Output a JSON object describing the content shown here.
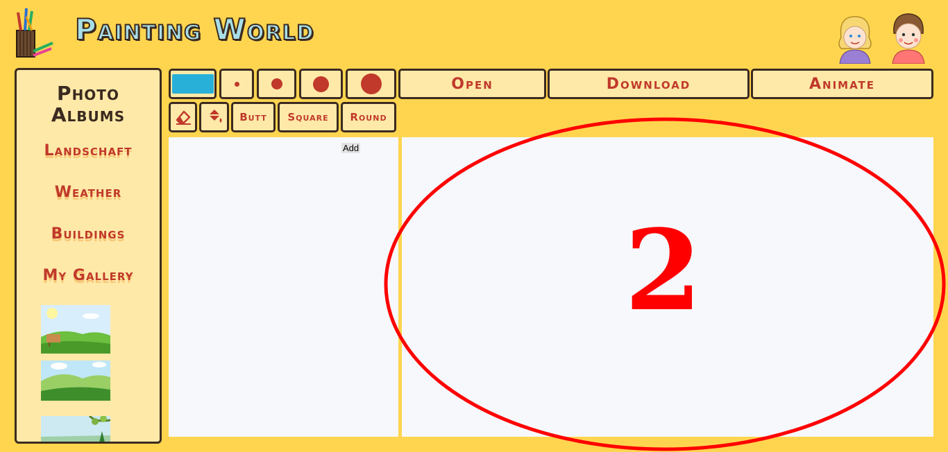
{
  "app": {
    "title": "Painting World"
  },
  "header": {
    "logo_icon": "pencil-cup-icon",
    "avatars": [
      "girl-avatar-icon",
      "boy-avatar-icon"
    ]
  },
  "sidebar": {
    "title": "Photo Albums",
    "albums": [
      {
        "label": "Landschaft"
      },
      {
        "label": "Weather"
      },
      {
        "label": "Buildings"
      },
      {
        "label": "My Gallery"
      }
    ],
    "thumbnail_icons": [
      "meadow-sign-thumbnail",
      "hills-clouds-thumbnail",
      "tree-branch-thumbnail"
    ]
  },
  "toolbar": {
    "selected_color": "#29b0d9",
    "brush_sizes": [
      "brush-size-xs",
      "brush-size-s",
      "brush-size-m",
      "brush-size-l"
    ],
    "open_label": "Open",
    "download_label": "Download",
    "animate_label": "Animate",
    "eraser_icon": "eraser-icon",
    "fill_icon": "paint-bucket-icon",
    "cap_butt_label": "Butt",
    "cap_square_label": "Square",
    "cap_round_label": "Round"
  },
  "side_panel": {
    "add_label": "Add"
  },
  "annotation": {
    "number": "2",
    "color": "#ff0000"
  },
  "colors": {
    "background": "#ffd54f",
    "panel": "#ffe9a8",
    "border": "#3b2a20",
    "accent": "#c0392b",
    "canvas": "#f6f8fc"
  }
}
